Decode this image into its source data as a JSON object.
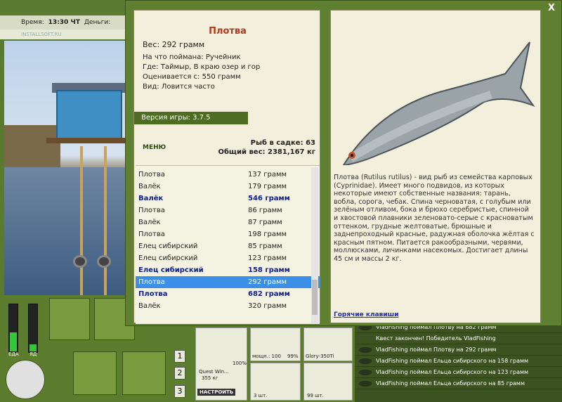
{
  "topbar": {
    "time_label": "Время:",
    "time_value": "13:30 ЧТ",
    "money_label": "Деньги:"
  },
  "logo": "INSTALLSOFT.RU",
  "meters": {
    "food_label": "ЕДА",
    "poison_label": "ЯД",
    "food_level": 0.4,
    "poison_level": 0.15
  },
  "tabs": [
    "1",
    "2",
    "3"
  ],
  "tackle": {
    "line_name": "Quest Win...",
    "line_size": "355 кг",
    "line_percent": "100%",
    "configure_label": "НАСТРОИТЬ",
    "reel_label": "мощн.: 100",
    "reel_percent": "99%",
    "bait_name": "Glory-350Ti",
    "hook_count": "3 шт.",
    "bait_count": "99 шт."
  },
  "log": [
    "VladFishing поймал Плотву на 682 грамм",
    "Квест закончен! Победитель VladFishing",
    "VladFishing поймал Плотву на 292 грамм",
    "VladFishing поймал Ельца сибирского на 158 грамм",
    "VladFishing поймал Ельца сибирского на 123 грамм",
    "VladFishing поймал Ельца сибирского на 85 грамм"
  ],
  "modal": {
    "close": "X",
    "fish_name": "Плотва",
    "weight": "Вес: 292 грамм",
    "caught_with": "На что поймана: Ручейник",
    "location": "Где: Таймыр, В краю озер и гор",
    "value": "Оценивается с: 550 грамм",
    "kind": "Вид: Ловится часто",
    "version": "Версия игры: 3.7.5",
    "menu": "МЕНЮ",
    "in_cage": "Рыб в садке: 63",
    "total_weight": "Общий вес: 2381,167 кг",
    "catch_list": [
      {
        "name": "Плотва",
        "weight": "137 грамм",
        "bold": false,
        "selected": false
      },
      {
        "name": "Валёк",
        "weight": "179 грамм",
        "bold": false,
        "selected": false
      },
      {
        "name": "Валёк",
        "weight": "546 грамм",
        "bold": true,
        "selected": false
      },
      {
        "name": "Плотва",
        "weight": "86 грамм",
        "bold": false,
        "selected": false
      },
      {
        "name": "Валёк",
        "weight": "87 грамм",
        "bold": false,
        "selected": false
      },
      {
        "name": "Плотва",
        "weight": "198 грамм",
        "bold": false,
        "selected": false
      },
      {
        "name": "Елец сибирский",
        "weight": "85 грамм",
        "bold": false,
        "selected": false
      },
      {
        "name": "Елец сибирский",
        "weight": "123 грамм",
        "bold": false,
        "selected": false
      },
      {
        "name": "Елец сибирский",
        "weight": "158 грамм",
        "bold": true,
        "selected": false
      },
      {
        "name": "Плотва",
        "weight": "292 грамм",
        "bold": false,
        "selected": true
      },
      {
        "name": "Плотва",
        "weight": "682 грамм",
        "bold": true,
        "selected": false
      },
      {
        "name": "Валёк",
        "weight": "320 грамм",
        "bold": false,
        "selected": false
      }
    ],
    "description": "Плотва (Rutilus rutilus) - вид рыб из семейства карповых (Cyprinidae). Имеет много подвидов, из которых некоторые имеют собственные названия: тарань, вобла, сорога, чебак. Спина черноватая, с голубым или зелёным отливом, бока и брюхо серебристые, спинной и хвостовой плавники зеленовато-серые с красноватым оттенком, грудные желтоватые, брюшные и заднепроходный красные, радужная оболочка жёлтая с красным пятном. Питается ракообразными, червями, моллюсками, личинками насекомых. Достигает длины 45 см и массы 2 кг.",
    "hotkeys": "Горячие клавиши"
  }
}
